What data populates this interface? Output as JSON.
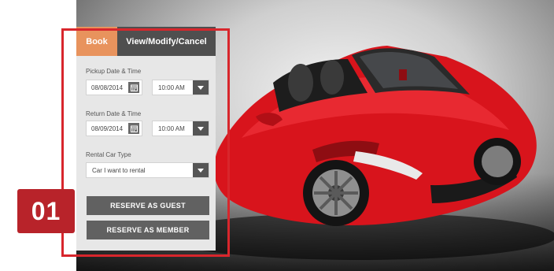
{
  "tabs": {
    "book": "Book",
    "view_modify_cancel": "View/Modify/Cancel"
  },
  "pickup": {
    "label": "Pickup Date & Time",
    "date": "08/08/2014",
    "time": "10:00 AM"
  },
  "return": {
    "label": "Return Date & Time",
    "date": "08/09/2014",
    "time": "10:00 AM"
  },
  "rental_car_type": {
    "label": "Rental Car Type",
    "selected": "Car I want to rental"
  },
  "buttons": {
    "reserve_guest": "RESERVE AS GUEST",
    "reserve_member": "RESERVE AS MEMBER"
  },
  "step_badge": "01",
  "icons": {
    "calendar": "calendar-icon",
    "dropdown": "chevron-down-icon"
  },
  "colors": {
    "book_tab": "#e8935d",
    "tab_dark": "#4f4f4f",
    "highlight": "#d8262c",
    "badge": "#b8232a",
    "button": "#616161",
    "panel": "#e7e7e7",
    "car_body": "#d8141c"
  }
}
